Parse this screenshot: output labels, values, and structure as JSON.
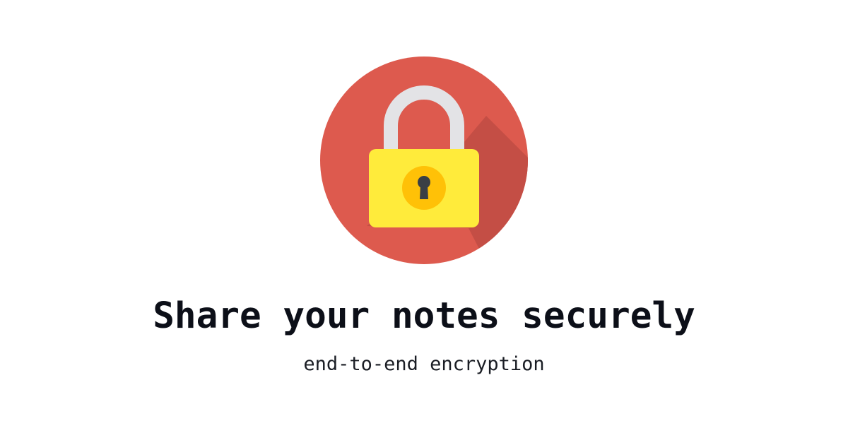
{
  "hero": {
    "icon": "padlock-icon",
    "colors": {
      "circle": "#dd5a4e",
      "shadow": "#c44e45",
      "shackle": "#e3e3e6",
      "lock_body": "#ffeb3b",
      "keyhole_ring": "#ffc107",
      "keyhole": "#3a3f45"
    }
  },
  "headline": "Share your notes securely",
  "subline": "end-to-end encryption"
}
